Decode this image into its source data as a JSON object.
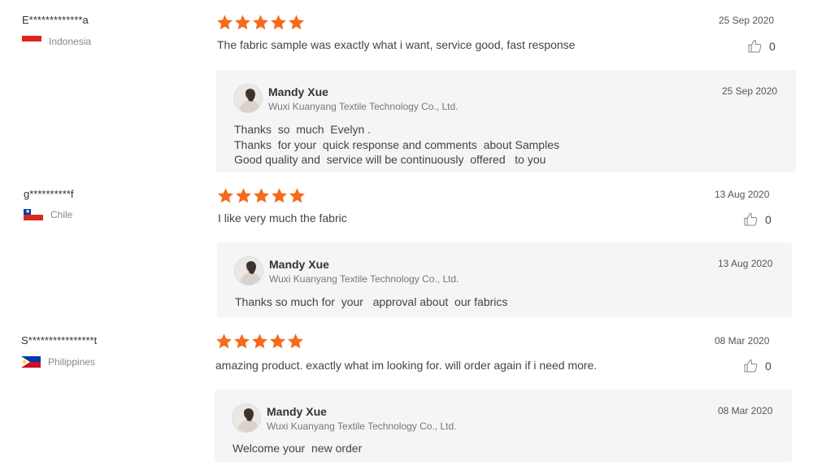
{
  "colors": {
    "star": "#f56b1b",
    "reply_bg": "#f4f5f7",
    "text": "#444444",
    "muted": "#888888"
  },
  "icons": {
    "star": "star-icon",
    "like": "thumbs-up-icon",
    "avatar": "avatar-photo"
  },
  "reviews": [
    {
      "user": "E*************a",
      "country": "Indonesia",
      "rating": 5,
      "date": "25 Sep 2020",
      "text": "The fabric sample was exactly what i want, service good, fast response",
      "likes": "0",
      "reply": {
        "name": "Mandy Xue",
        "company": "Wuxi Kuanyang Textile Technology Co., Ltd.",
        "date": "25 Sep 2020",
        "lines": [
          "Thanks  so  much  Evelyn .",
          "Thanks  for your  quick response and comments  about Samples",
          "Good quality and  service will be continuously  offered   to you"
        ]
      }
    },
    {
      "user": "g**********f",
      "country": "Chile",
      "rating": 5,
      "date": "13 Aug 2020",
      "text": "I like very much the fabric",
      "likes": "0",
      "reply": {
        "name": "Mandy Xue",
        "company": "Wuxi Kuanyang Textile Technology Co., Ltd.",
        "date": "13 Aug 2020",
        "lines": [
          "Thanks so much for  your   approval about  our fabrics"
        ]
      }
    },
    {
      "user": "S****************t",
      "country": "Philippines",
      "rating": 5,
      "date": "08 Mar 2020",
      "text": "amazing product. exactly what im looking for. will order again if i need more.",
      "likes": "0",
      "reply": {
        "name": "Mandy Xue",
        "company": "Wuxi Kuanyang Textile Technology Co., Ltd.",
        "date": "08 Mar 2020",
        "lines": [
          "Welcome your  new order"
        ]
      }
    }
  ]
}
